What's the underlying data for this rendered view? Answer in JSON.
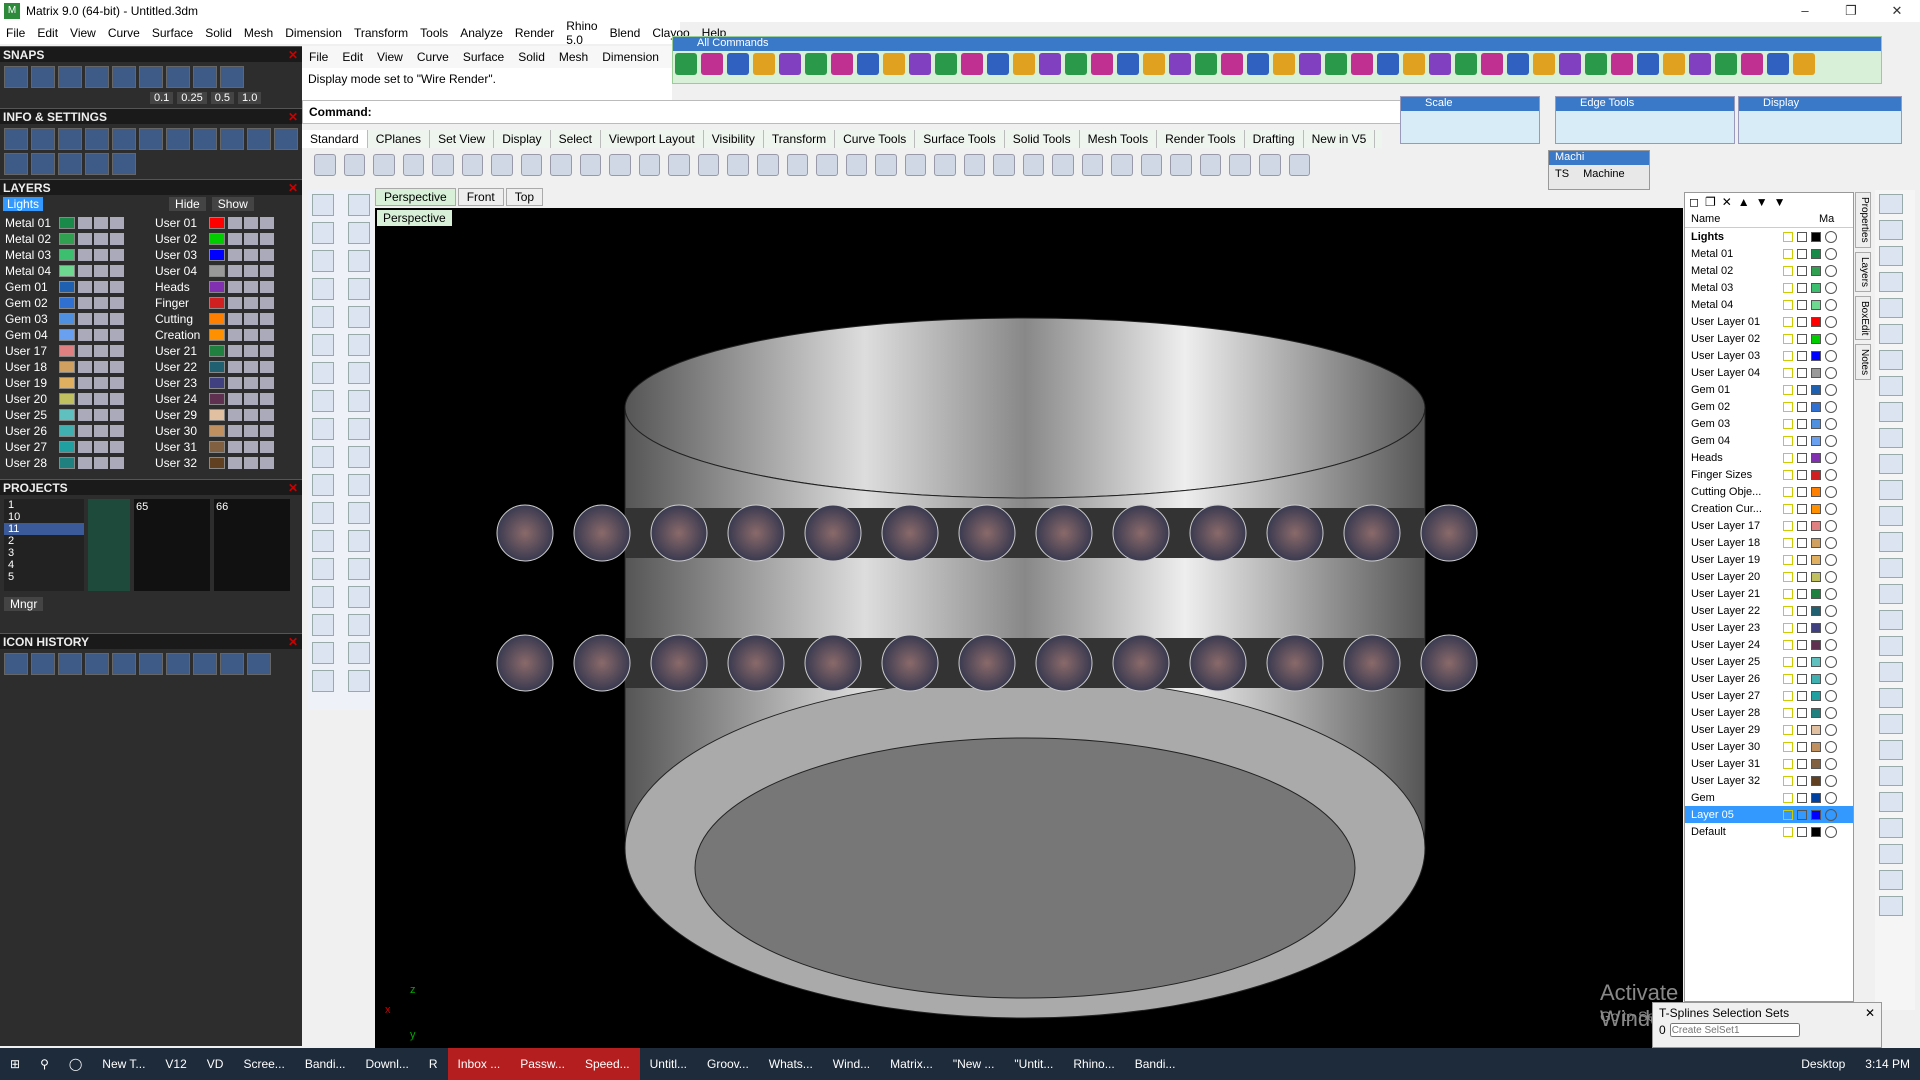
{
  "window": {
    "title": "Matrix 9.0 (64-bit) - Untitled.3dm"
  },
  "main_menu": [
    "File",
    "Edit",
    "View",
    "Curve",
    "Surface",
    "Solid",
    "Mesh",
    "Dimension",
    "Transform",
    "Tools",
    "Analyze",
    "Render",
    "Rhino 5.0",
    "Blend",
    "Clayoo",
    "Help"
  ],
  "rhino_menu": [
    "File",
    "Edit",
    "View",
    "Curve",
    "Surface",
    "Solid",
    "Mesh",
    "Dimension"
  ],
  "command": {
    "history": "Display mode set to \"Wire Render\".",
    "label": "Command:"
  },
  "all_commands_label": "All Commands",
  "floating_toolbars": {
    "scale": "Scale",
    "edge_tools": "Edge Tools",
    "display": "Display",
    "machine_title": "Machi",
    "ts": "TS",
    "machine": "Machine"
  },
  "tool_tabs": [
    "Standard",
    "CPlanes",
    "Set View",
    "Display",
    "Select",
    "Viewport Layout",
    "Visibility",
    "Transform",
    "Curve Tools",
    "Surface Tools",
    "Solid Tools",
    "Mesh Tools",
    "Render Tools",
    "Drafting",
    "New in V5"
  ],
  "view_tabs": [
    "Perspective",
    "Front",
    "Top"
  ],
  "viewport_label": "Perspective",
  "panels": {
    "snaps": "SNAPS",
    "info": "INFO & SETTINGS",
    "layers": "LAYERS",
    "projects": "PROJECTS",
    "icon_history": "ICON HISTORY",
    "hide": "Hide",
    "show": "Show",
    "mngr": "Mngr",
    "snap_values": [
      "0.1",
      "0.25",
      "0.5",
      "1.0"
    ]
  },
  "left_layers": {
    "lights": "Lights",
    "col1": [
      "Metal 01",
      "Metal 02",
      "Metal 03",
      "Metal 04",
      "Gem 01",
      "Gem 02",
      "Gem 03",
      "Gem 04",
      "User 17",
      "User 18",
      "User 19",
      "User 20",
      "User 25",
      "User 26",
      "User 27",
      "User 28"
    ],
    "col2": [
      "User 01",
      "User 02",
      "User 03",
      "User 04",
      "Heads",
      "Finger",
      "Cutting",
      "Creation",
      "User 21",
      "User 22",
      "User 23",
      "User 24",
      "User 29",
      "User 30",
      "User 31",
      "User 32"
    ]
  },
  "project_numbers": [
    "1",
    "10",
    "11",
    "2",
    "3",
    "4",
    "5"
  ],
  "project_thumbs": [
    "65",
    "66"
  ],
  "right_layers": {
    "header_name": "Name",
    "header_ma": "Ma",
    "rows": [
      "Lights",
      "Metal 01",
      "Metal 02",
      "Metal 03",
      "Metal 04",
      "User Layer 01",
      "User Layer 02",
      "User Layer 03",
      "User Layer 04",
      "Gem 01",
      "Gem 02",
      "Gem 03",
      "Gem 04",
      "Heads",
      "Finger Sizes",
      "Cutting Obje...",
      "Creation Cur...",
      "User Layer 17",
      "User Layer 18",
      "User Layer 19",
      "User Layer 20",
      "User Layer 21",
      "User Layer 22",
      "User Layer 23",
      "User Layer 24",
      "User Layer 25",
      "User Layer 26",
      "User Layer 27",
      "User Layer 28",
      "User Layer 29",
      "User Layer 30",
      "User Layer 31",
      "User Layer 32",
      "Gem",
      "Layer 05",
      "Default"
    ],
    "selected": "Layer 05"
  },
  "side_tabs": [
    "Properties",
    "Layers",
    "BoxEdit",
    "Notes"
  ],
  "watermark": {
    "line1": "Activate Windows",
    "line2": "Go to Settings to activate Windows."
  },
  "tsplines": {
    "title": "T-Splines Selection Sets",
    "count": "0",
    "placeholder": "Create SelSet1"
  },
  "axes": {
    "x": "x",
    "y": "y",
    "z": "z"
  },
  "taskbar": {
    "items": [
      "New T...",
      "V12",
      "VD",
      "Scree...",
      "Bandi...",
      "Downl...",
      "R",
      "Inbox ...",
      "Passw...",
      "Speed...",
      "Untitl...",
      "Groov...",
      "Whats...",
      "Wind...",
      "Matrix...",
      "\"New ...",
      "\"Untit...",
      "Rhino...",
      "Bandi..."
    ],
    "desktop": "Desktop",
    "time": "3:14 PM"
  }
}
